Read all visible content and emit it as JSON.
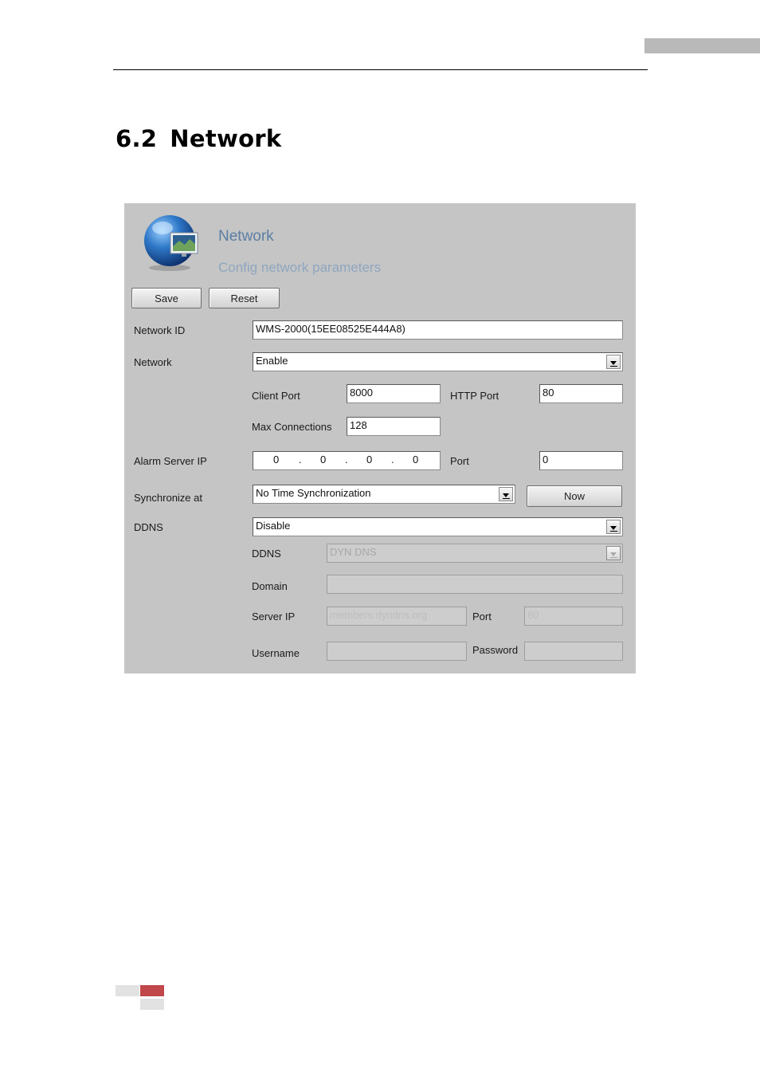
{
  "page": {
    "section_number": "6.2",
    "section_title": "Network",
    "colors": {
      "corner_tab": "#b9b9b9",
      "footer_accent": "#c0474a",
      "footer_gray": "#e2e2e2"
    }
  },
  "dialog": {
    "icon": "globe-monitor-icon",
    "title": "Network",
    "subtitle": "Config network parameters",
    "save_label": "Save",
    "reset_label": "Reset",
    "network_id": {
      "label": "Network ID",
      "value": "WMS-2000(15EE08525E444A8)"
    },
    "network": {
      "label": "Network",
      "selected": "Enable"
    },
    "client_port": {
      "label": "Client Port",
      "value": "8000"
    },
    "http_port": {
      "label": "HTTP Port",
      "value": "80"
    },
    "max_connections": {
      "label": "Max Connections",
      "value": "128"
    },
    "alarm_server_ip": {
      "label": "Alarm Server IP",
      "octets": [
        "0",
        "0",
        "0",
        "0"
      ]
    },
    "alarm_port": {
      "label": "Port",
      "value": "0"
    },
    "synchronize": {
      "label": "Synchronize at",
      "selected": "No Time Synchronization",
      "now_label": "Now"
    },
    "ddns": {
      "label": "DDNS",
      "selected": "Disable"
    },
    "ddns_sub": {
      "provider_label": "DDNS",
      "provider_selected": "DYN DNS",
      "domain_label": "Domain",
      "domain_value": "",
      "server_ip_label": "Server IP",
      "server_ip_value": "members.dyndns.org",
      "port_label": "Port",
      "port_value": "80",
      "username_label": "Username",
      "username_value": "",
      "password_label": "Password",
      "password_value": ""
    }
  }
}
